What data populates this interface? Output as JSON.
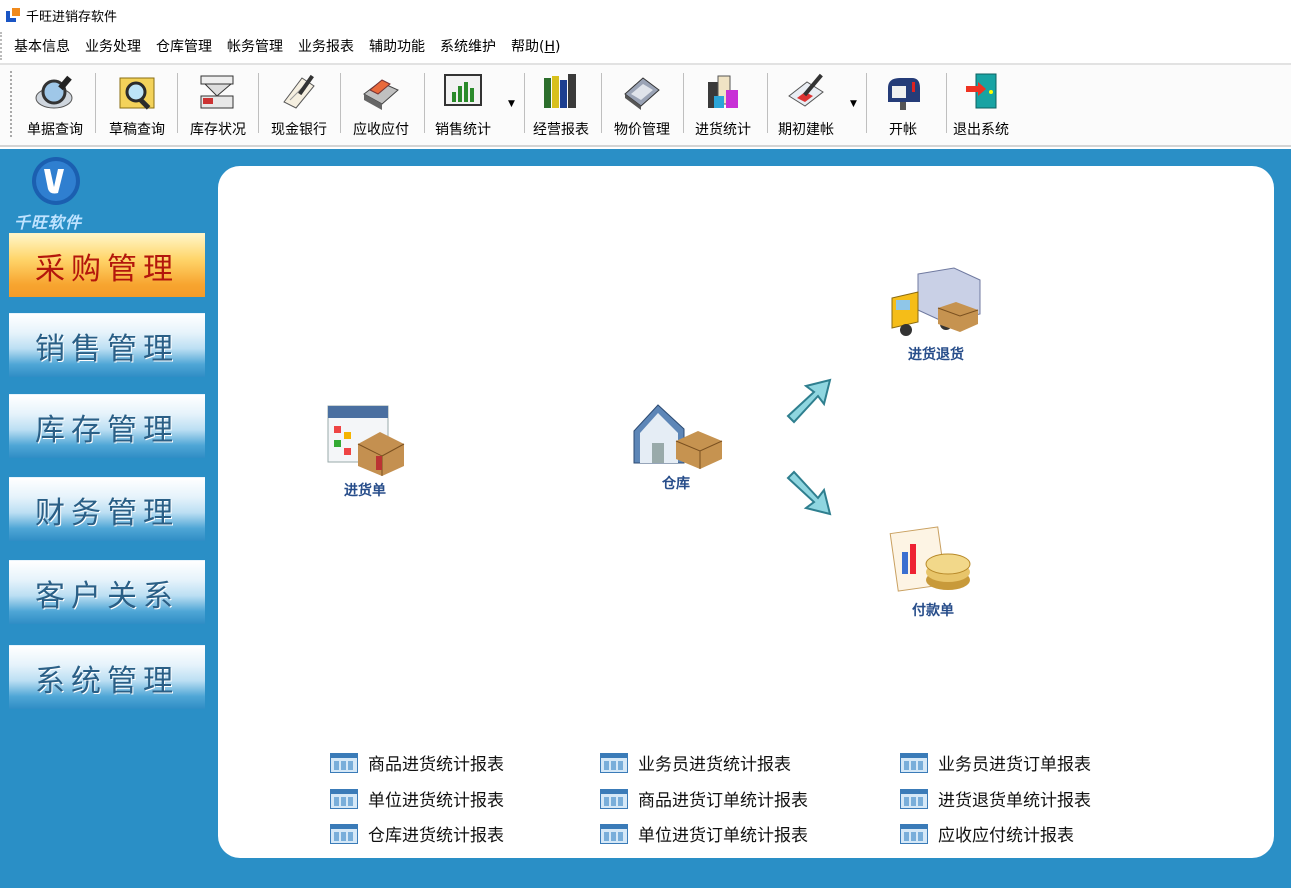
{
  "window": {
    "title": "千旺进销存软件"
  },
  "menu": [
    {
      "label": "基本信息"
    },
    {
      "label": "业务处理"
    },
    {
      "label": "仓库管理"
    },
    {
      "label": "帐务管理"
    },
    {
      "label": "业务报表"
    },
    {
      "label": "辅助功能"
    },
    {
      "label": "系统维护"
    },
    {
      "label": "帮助(",
      "hotkey": "H",
      "suffix": ")"
    }
  ],
  "toolbar": [
    {
      "label": "单据查询",
      "icon": "magnifier-icon"
    },
    {
      "label": "草稿查询",
      "icon": "folder-search-icon"
    },
    {
      "label": "库存状况",
      "icon": "scanner-icon"
    },
    {
      "label": "现金银行",
      "icon": "scroll-pen-icon"
    },
    {
      "label": "应收应付",
      "icon": "cash-register-icon"
    },
    {
      "label": "销售统计",
      "icon": "bar-chart-icon"
    },
    {
      "label": "经营报表",
      "icon": "books-icon"
    },
    {
      "label": "物价管理",
      "icon": "calculator-icon"
    },
    {
      "label": "进货统计",
      "icon": "boxes-icon"
    },
    {
      "label": "期初建帐",
      "icon": "ledger-pen-icon"
    },
    {
      "label": "开帐",
      "icon": "mailbox-icon"
    },
    {
      "label": "退出系统",
      "icon": "exit-door-icon"
    }
  ],
  "sidebar": {
    "logo_text": "千旺软件",
    "items": [
      {
        "label": "采购管理",
        "active": true
      },
      {
        "label": "销售管理"
      },
      {
        "label": "库存管理"
      },
      {
        "label": "财务管理"
      },
      {
        "label": "客户关系"
      },
      {
        "label": "系统管理"
      }
    ]
  },
  "flow": {
    "purchase_order": "进货单",
    "warehouse": "仓库",
    "purchase_return": "进货退货",
    "payment_order": "付款单"
  },
  "reports": [
    [
      "商品进货统计报表",
      "单位进货统计报表",
      "仓库进货统计报表"
    ],
    [
      "业务员进货统计报表",
      "商品进货订单统计报表",
      "单位进货订单统计报表"
    ],
    [
      "业务员进货订单报表",
      "进货退货单统计报表",
      "应收应付统计报表"
    ]
  ],
  "colors": {
    "main_bg": "#2a8fc6",
    "active_nav": "#f7a530",
    "nav_text": "#2a5f86",
    "flow_label": "#274d8a"
  }
}
